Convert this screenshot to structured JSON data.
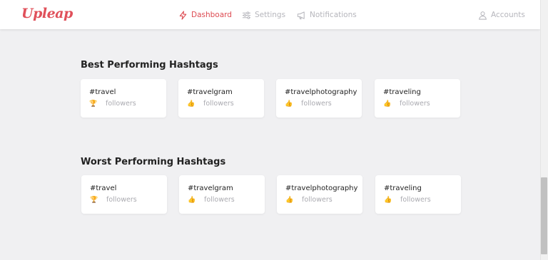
{
  "brand": {
    "logo_text": "Upleap",
    "accent_color": "#dd4b52"
  },
  "nav": {
    "dashboard": {
      "label": "Dashboard",
      "icon": "lightning-icon",
      "active": true
    },
    "settings": {
      "label": "Settings",
      "icon": "sliders-icon"
    },
    "notifications": {
      "label": "Notifications",
      "icon": "megaphone-icon"
    },
    "accounts": {
      "label": "Accounts",
      "icon": "user-icon"
    }
  },
  "best": {
    "title": "Best Performing Hashtags",
    "cards": [
      {
        "tag": "#travel",
        "icon": "trophy-icon",
        "glyph": "🏆",
        "meta": "followers"
      },
      {
        "tag": "#travelgram",
        "icon": "thumbs-up-icon",
        "glyph": "👍",
        "meta": "followers"
      },
      {
        "tag": "#travelphotography",
        "icon": "thumbs-up-icon",
        "glyph": "👍",
        "meta": "followers"
      },
      {
        "tag": "#traveling",
        "icon": "thumbs-up-icon",
        "glyph": "👍",
        "meta": "followers"
      }
    ]
  },
  "worst": {
    "title": "Worst Performing Hashtags",
    "cards": [
      {
        "tag": "#travel",
        "icon": "trophy-icon",
        "glyph": "🏆",
        "meta": "followers"
      },
      {
        "tag": "#travelgram",
        "icon": "thumbs-up-icon",
        "glyph": "👍",
        "meta": "followers"
      },
      {
        "tag": "#travelphotography",
        "icon": "thumbs-up-icon",
        "glyph": "👍",
        "meta": "followers"
      },
      {
        "tag": "#traveling",
        "icon": "thumbs-up-icon",
        "glyph": "👍",
        "meta": "followers"
      }
    ]
  }
}
